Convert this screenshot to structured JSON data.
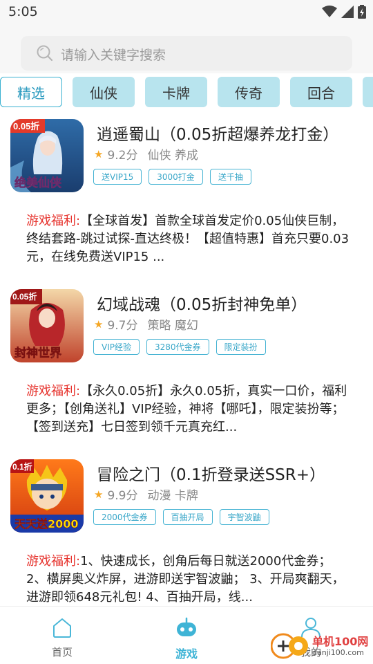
{
  "status": {
    "time": "5:05"
  },
  "search": {
    "placeholder": "请输入关键字搜索"
  },
  "tabs": [
    {
      "label": "精选",
      "active": true
    },
    {
      "label": "仙侠"
    },
    {
      "label": "卡牌"
    },
    {
      "label": "传奇"
    },
    {
      "label": "回合"
    }
  ],
  "games": [
    {
      "title": "逍遥蜀山（0.05折超爆养龙打金）",
      "score": "9.2分",
      "genre": "仙侠 养成",
      "tags": [
        "送VIP15",
        "3000打金",
        "送千抽"
      ],
      "icon_badge": "0.05折",
      "icon_caption": "绝美仙侠",
      "benefit_label": "游戏福利:",
      "benefit_text": "【全球首发】首款全球首发定价0.05仙侠巨制，终结套路-跳过试探-直达终极！【超值特惠】首充只要0.03元，在线免费送VIP15 ..."
    },
    {
      "title": "幻域战魂（0.05折封神免单）",
      "score": "9.7分",
      "genre": "策略 魔幻",
      "tags": [
        "VIP经验",
        "3280代金券",
        "限定装扮"
      ],
      "icon_badge": "0.05折",
      "icon_caption": "封神世界",
      "benefit_label": "游戏福利:",
      "benefit_text": "【永久0.05折】永久0.05折，真实一口价，福利更多；【创角送礼】VIP经验，神将【哪吒】，限定装扮等；【签到送充】七日签到领千元真充红..."
    },
    {
      "title": "冒险之门（0.1折登录送SSR+）",
      "score": "9.9分",
      "genre": "动漫 卡牌",
      "tags": [
        "2000代金券",
        "百抽开局",
        "宇智波鼬"
      ],
      "icon_badge": "0.1折",
      "icon_caption": "天天送2000",
      "benefit_label": "游戏福利:",
      "benefit_text": "1、快速成长，创角后每日就送2000代金券； 2、横屏奥义炸屏，进游即送宇智波鼬； 3、开局爽翻天，进游即领648元礼包! 4、百抽开局，线..."
    }
  ],
  "nav": [
    {
      "label": "首页",
      "icon": "home-icon"
    },
    {
      "label": "游戏",
      "icon": "gamepad-icon",
      "active": true
    },
    {
      "label": "我的",
      "icon": "user-icon"
    }
  ],
  "watermark": {
    "title": "单机100网",
    "url": "danji100.com"
  },
  "colors": {
    "accent": "#3fb4d6",
    "tab_bg": "#b8e4ee",
    "benefit_label": "#e6322c",
    "star": "#f5a623"
  }
}
